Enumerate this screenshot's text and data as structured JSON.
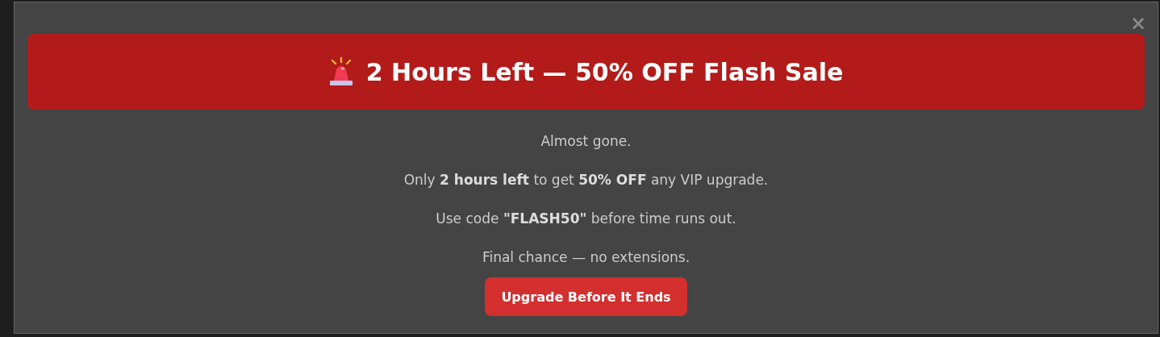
{
  "close_button": "×",
  "banner": {
    "title": "2 Hours Left — 50% OFF Flash Sale"
  },
  "body_lines": [
    "Almost gone.",
    "Only **2 hours left** to get **50% OFF** any VIP upgrade.",
    "Use code **\"FLASH50\"** before time runs out.",
    "Final chance — no extensions."
  ],
  "cta_button": "Upgrade Before It Ends"
}
